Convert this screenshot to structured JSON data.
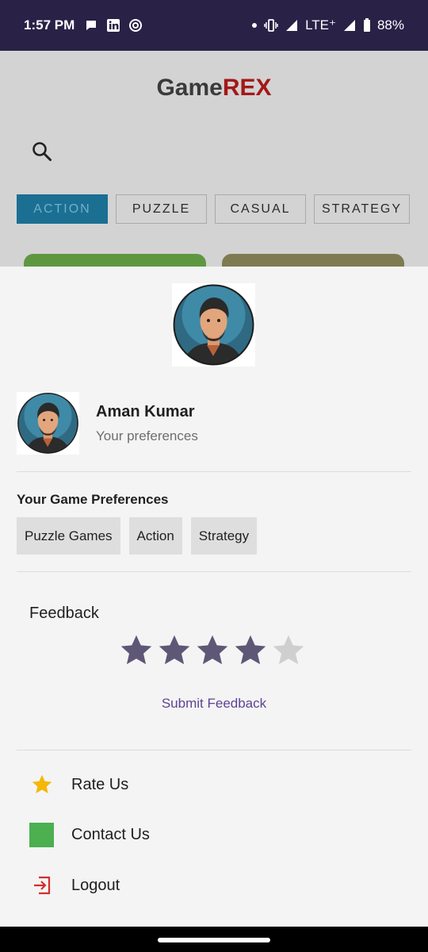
{
  "status_bar": {
    "time": "1:57 PM",
    "network": "LTE⁺",
    "battery": "88%",
    "left_icons": [
      "chat-bubble-icon",
      "linkedin-icon",
      "app-notification-icon"
    ],
    "right_icons": [
      "dot-icon",
      "vibrate-icon",
      "signal-icon",
      "signal-icon",
      "battery-icon"
    ]
  },
  "app": {
    "title_part1": "Game",
    "title_part2": "REX",
    "title_colors": {
      "part1": "#3a3a3a",
      "part2": "#a31818"
    },
    "categories": [
      {
        "label": "ACTION",
        "selected": true
      },
      {
        "label": "PUZZLE",
        "selected": false
      },
      {
        "label": "CASUAL",
        "selected": false
      },
      {
        "label": "STRATEGY",
        "selected": false
      }
    ]
  },
  "sheet": {
    "user_name": "Aman Kumar",
    "subtitle": "Your preferences",
    "preferences_title": "Your Game Preferences",
    "preferences": [
      "Puzzle Games",
      "Action",
      "Strategy"
    ],
    "feedback_title": "Feedback",
    "rating": 4,
    "rating_max": 5,
    "submit_label": "Submit Feedback",
    "menu": [
      {
        "icon": "star-icon",
        "label": "Rate Us"
      },
      {
        "icon": "green-square-icon",
        "label": "Contact Us"
      },
      {
        "icon": "logout-icon",
        "label": "Logout"
      }
    ],
    "colors": {
      "star_filled": "#5f5776",
      "star_empty": "#cfcfcf",
      "accent": "#5e4493",
      "rate_star": "#f5b70a",
      "contact": "#4caf50",
      "logout": "#d32f2f"
    }
  }
}
